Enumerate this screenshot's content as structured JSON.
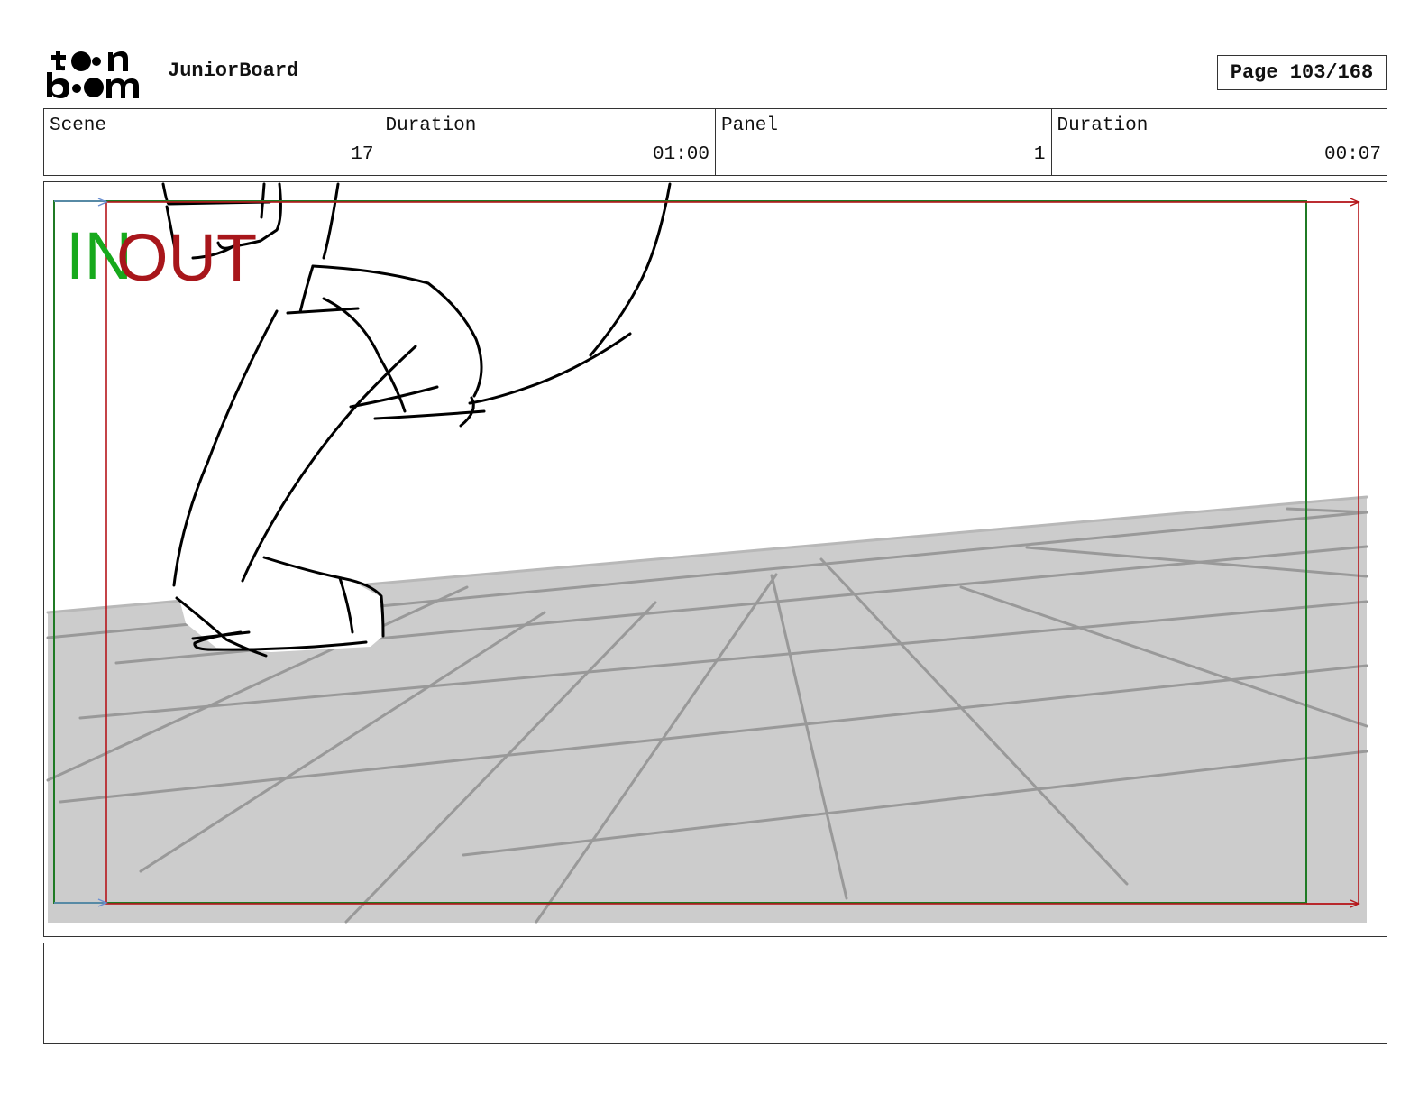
{
  "header": {
    "logo": {
      "line1": "toon",
      "line2": "boom"
    },
    "app_name": "JuniorBoard",
    "page_label": "Page 103/168"
  },
  "info": [
    {
      "label": "Scene",
      "value": "17"
    },
    {
      "label": "Duration",
      "value": "01:00"
    },
    {
      "label": "Panel",
      "value": "1"
    },
    {
      "label": "Duration",
      "value": "00:07"
    }
  ],
  "panel": {
    "in_marker": "IN",
    "out_marker": "OUT",
    "colors": {
      "in": "#17a91c",
      "out": "#a8161b",
      "floor": "#cccccc",
      "floor_lines": "#999999",
      "sketch": "#000000"
    }
  },
  "notes": {
    "text": ""
  }
}
